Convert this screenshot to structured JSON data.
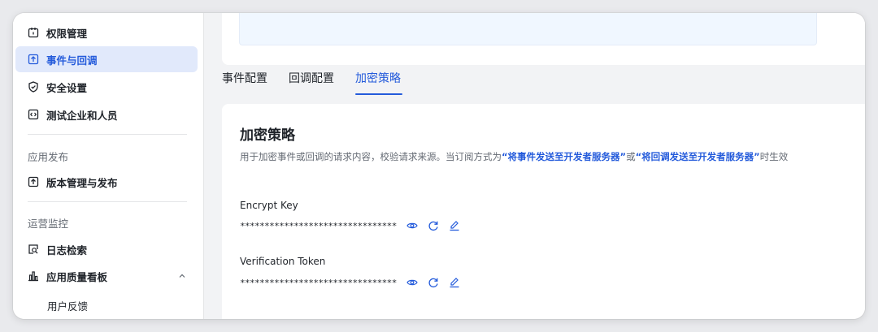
{
  "sidebar": {
    "items": [
      {
        "label": "权限管理",
        "icon": "permission-icon"
      },
      {
        "label": "事件与回调",
        "icon": "event-callback-icon",
        "active": true
      },
      {
        "label": "安全设置",
        "icon": "shield-check-icon"
      },
      {
        "label": "测试企业和人员",
        "icon": "test-tenant-icon"
      }
    ],
    "sections": [
      {
        "label": "应用发布",
        "items": [
          {
            "label": "版本管理与发布",
            "icon": "upload-icon"
          }
        ]
      },
      {
        "label": "运营监控",
        "items": [
          {
            "label": "日志检索",
            "icon": "log-search-icon"
          },
          {
            "label": "应用质量看板",
            "icon": "chart-icon",
            "expanded": true,
            "children": [
              "用户反馈"
            ]
          }
        ]
      }
    ]
  },
  "tabs": [
    {
      "label": "事件配置"
    },
    {
      "label": "回调配置"
    },
    {
      "label": "加密策略",
      "active": true
    }
  ],
  "encryption": {
    "title": "加密策略",
    "desc_prefix": "用于加密事件或回调的请求内容，校验请求来源。当订阅方式为",
    "link1": "“将事件发送至开发者服务器”",
    "desc_mid": "或",
    "link2": "“将回调发送至开发者服务器”",
    "desc_suffix": "时生效",
    "fields": [
      {
        "label": "Encrypt Key",
        "value": "********************************"
      },
      {
        "label": "Verification Token",
        "value": "********************************"
      }
    ]
  },
  "colors": {
    "accent": "#245bdb",
    "active_bg": "#e1e9fb",
    "text_secondary": "#646a73"
  }
}
